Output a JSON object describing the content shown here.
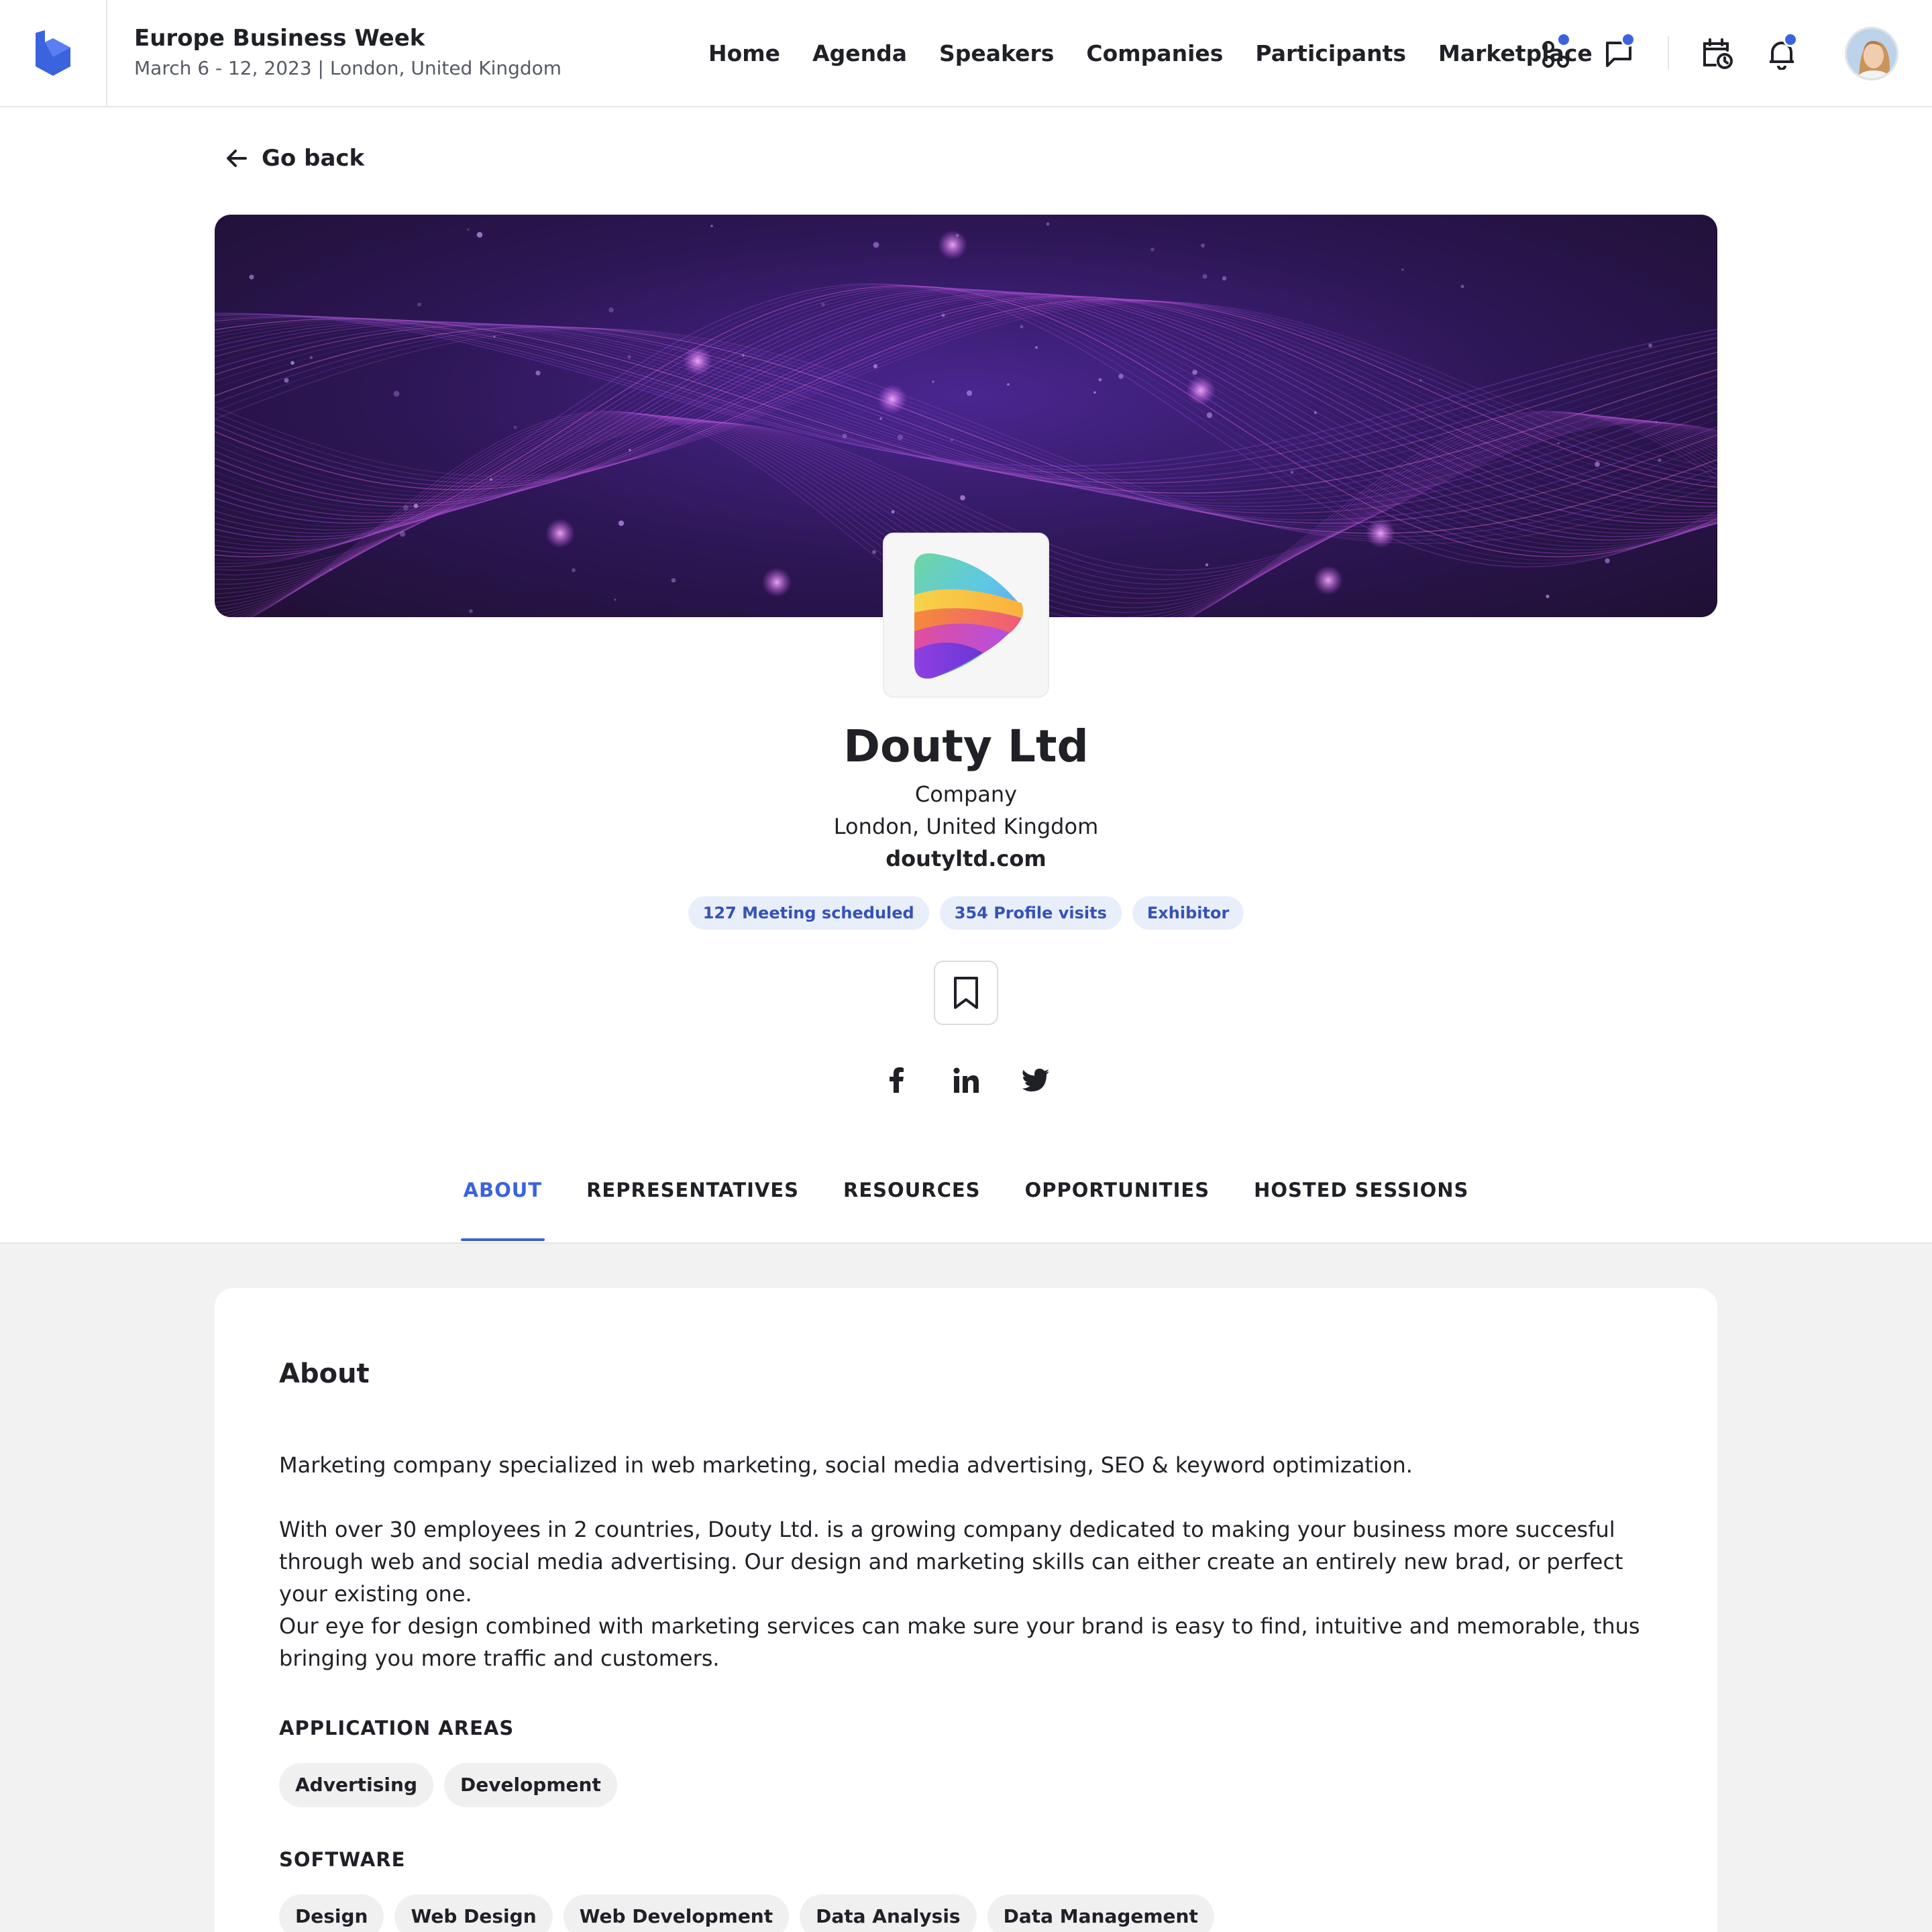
{
  "header": {
    "event_title": "Europe Business Week",
    "event_subtitle": "March 6 - 12, 2023 | London, United Kingdom",
    "nav": [
      "Home",
      "Agenda",
      "Speakers",
      "Companies",
      "Participants",
      "Marketplace"
    ],
    "icons": [
      "apps-icon",
      "chat-icon",
      "calendar-clock-icon",
      "bell-icon"
    ],
    "accent_color": "#3b63dd"
  },
  "back": {
    "label": "Go back"
  },
  "profile": {
    "name": "Douty Ltd",
    "type": "Company",
    "location": "London, United Kingdom",
    "website": "doutyltd.com",
    "badges": [
      "127 Meeting scheduled",
      "354 Profile visits",
      "Exhibitor"
    ],
    "socials": [
      "facebook-icon",
      "linkedin-icon",
      "twitter-icon"
    ]
  },
  "tabs": {
    "items": [
      "ABOUT",
      "REPRESENTATIVES",
      "RESOURCES",
      "OPPORTUNITIES",
      "HOSTED SESSIONS"
    ],
    "active": "ABOUT"
  },
  "about": {
    "title": "About",
    "paragraphs": [
      "Marketing company specialized in web marketing, social media advertising, SEO & keyword optimization.",
      "With over 30 employees in 2 countries, Douty Ltd. is a growing company dedicated to making your business more succesful through web and social media advertising. Our design and marketing skills can either create an entirely new brad, or perfect your existing one.",
      "Our eye for design combined with marketing services can make sure your brand is easy to find, intuitive and memorable, thus bringing you more traffic and customers."
    ],
    "application_areas_label": "APPLICATION AREAS",
    "application_areas": [
      "Advertising",
      "Development"
    ],
    "software_label": "SOFTWARE",
    "software": [
      "Design",
      "Web Design",
      "Web Development",
      "Data Analysis",
      "Data Management"
    ]
  }
}
